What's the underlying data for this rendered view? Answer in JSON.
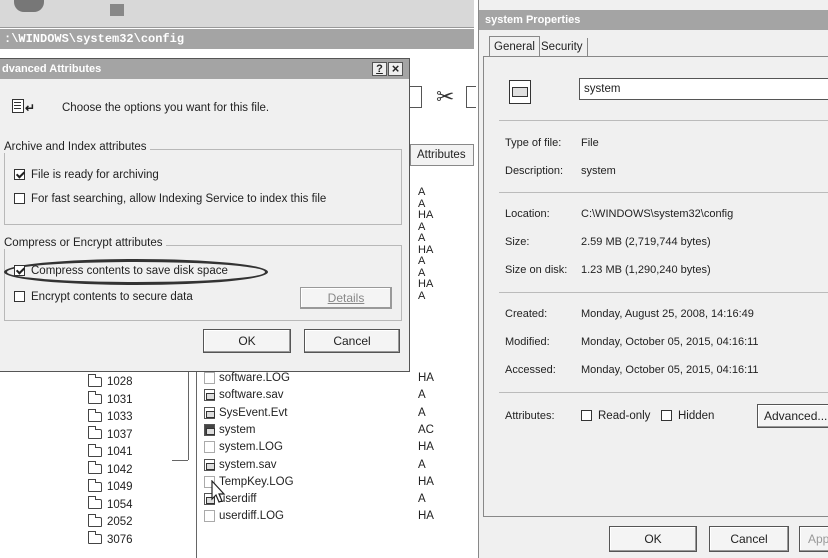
{
  "explorer": {
    "path": ":\\WINDOWS\\system32\\config",
    "attributes_header": "Attributes",
    "folders": [
      "1028",
      "1031",
      "1033",
      "1037",
      "1041",
      "1042",
      "1049",
      "1054",
      "2052",
      "3076"
    ],
    "files": [
      {
        "name": "software.LOG",
        "attr": "HA",
        "icon": "log-file-icon"
      },
      {
        "name": "software.sav",
        "attr": "A",
        "icon": "system-file-icon"
      },
      {
        "name": "SysEvent.Evt",
        "attr": "A",
        "icon": "system-file-icon"
      },
      {
        "name": "system",
        "attr": "AC",
        "icon": "system-file-icon"
      },
      {
        "name": "system.LOG",
        "attr": "HA",
        "icon": "log-file-icon"
      },
      {
        "name": "system.sav",
        "attr": "A",
        "icon": "system-file-icon"
      },
      {
        "name": "TempKey.LOG",
        "attr": "HA",
        "icon": "log-file-icon"
      },
      {
        "name": "userdiff",
        "attr": "A",
        "icon": "system-file-icon"
      },
      {
        "name": "userdiff.LOG",
        "attr": "HA",
        "icon": "log-file-icon"
      }
    ],
    "upper_attrs": [
      "A",
      "A",
      "HA",
      "A",
      "A",
      "HA",
      "A",
      "A",
      "HA",
      "A"
    ]
  },
  "advanced": {
    "title": "dvanced Attributes",
    "help": "?",
    "close": "×",
    "intro": "Choose the options you want for this file.",
    "archive_group": "Archive and Index attributes",
    "archive_label": "File is ready for archiving",
    "archive_checked": true,
    "index_label": "For fast searching, allow Indexing Service to index this file",
    "index_checked": false,
    "compress_group": "Compress or Encrypt attributes",
    "compress_label": "Compress contents to save disk space",
    "compress_checked": true,
    "encrypt_label": "Encrypt contents to secure data",
    "encrypt_checked": false,
    "details": "Details",
    "ok": "OK",
    "cancel": "Cancel"
  },
  "properties": {
    "title": "system Properties",
    "tabs": [
      "General",
      "Security"
    ],
    "filename": "system",
    "type_label": "Type of file:",
    "type_value": "File",
    "desc_label": "Description:",
    "desc_value": "system",
    "location_label": "Location:",
    "location_value": "C:\\WINDOWS\\system32\\config",
    "size_label": "Size:",
    "size_value": "2.59 MB (2,719,744 bytes)",
    "disk_label": "Size on disk:",
    "disk_value": "1.23 MB (1,290,240 bytes)",
    "created_label": "Created:",
    "created_value": "Monday, August 25, 2008, 14:16:49",
    "modified_label": "Modified:",
    "modified_value": "Monday, October 05, 2015, 04:16:11",
    "accessed_label": "Accessed:",
    "accessed_value": "Monday, October 05, 2015, 04:16:11",
    "attributes_label": "Attributes:",
    "readonly_label": "Read-only",
    "hidden_label": "Hidden",
    "advanced_button": "Advanced...",
    "ok": "OK",
    "cancel": "Cancel",
    "apply": "Appl"
  }
}
